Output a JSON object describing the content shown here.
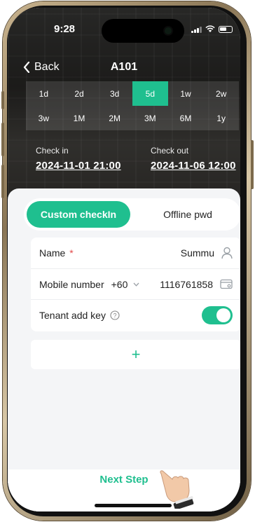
{
  "status_bar": {
    "time": "9:28"
  },
  "nav": {
    "back_label": "Back",
    "title": "A101"
  },
  "durations": [
    {
      "label": "1d",
      "active": false
    },
    {
      "label": "2d",
      "active": false
    },
    {
      "label": "3d",
      "active": false
    },
    {
      "label": "5d",
      "active": true
    },
    {
      "label": "1w",
      "active": false
    },
    {
      "label": "2w",
      "active": false
    },
    {
      "label": "3w",
      "active": false
    },
    {
      "label": "1M",
      "active": false
    },
    {
      "label": "2M",
      "active": false
    },
    {
      "label": "3M",
      "active": false
    },
    {
      "label": "6M",
      "active": false
    },
    {
      "label": "1y",
      "active": false
    }
  ],
  "check_in": {
    "label": "Check in",
    "value": "2024-11-01 21:00"
  },
  "check_out": {
    "label": "Check out",
    "value": "2024-11-06 12:00"
  },
  "tabs": {
    "active": "Custom checkIn",
    "inactive": "Offline pwd"
  },
  "form": {
    "name_label": "Name",
    "name_required": "*",
    "name_value": "Summu",
    "mobile_label": "Mobile number",
    "country_code": "+60",
    "mobile_value": "1116761858",
    "tenant_key_label": "Tenant add key",
    "tenant_key_enabled": true
  },
  "add_label": "+",
  "footer": {
    "next_label": "Next Step"
  },
  "colors": {
    "accent": "#1fbf8f",
    "required": "#e24a4a"
  }
}
